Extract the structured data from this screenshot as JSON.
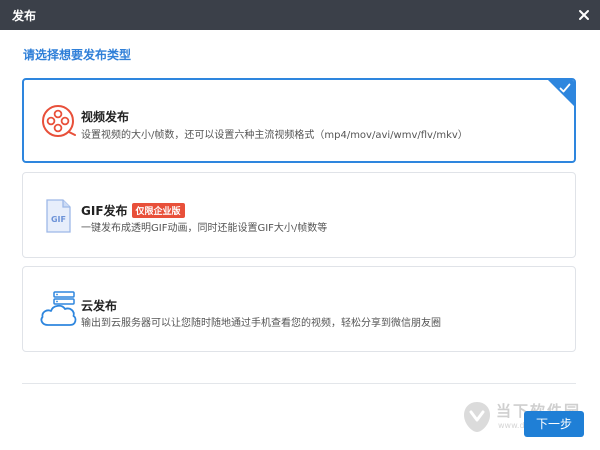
{
  "window": {
    "title": "发布"
  },
  "prompt": "请选择想要发布类型",
  "options": [
    {
      "name": "视频发布",
      "desc": "设置视频的大小/帧数，还可以设置六种主流视频格式（mp4/mov/avi/wmv/flv/mkv）",
      "icon": "film-reel-icon",
      "selected": true
    },
    {
      "name": "GIF发布",
      "badge": "仅限企业版",
      "desc": "一键发布成透明GIF动画，同时还能设置GIF大小/帧数等",
      "icon": "gif-file-icon",
      "selected": false
    },
    {
      "name": "云发布",
      "desc": "输出到云服务器可以让您随时随地通过手机查看您的视频，轻松分享到微信朋友圈",
      "icon": "cloud-server-icon",
      "selected": false
    }
  ],
  "footer": {
    "next_label": "下一步"
  },
  "watermark": {
    "text": "当下软件园",
    "url": "www.downxia.com"
  },
  "colors": {
    "accent": "#2e86de",
    "titlebar": "#3b4049",
    "badge": "#e8503a"
  }
}
